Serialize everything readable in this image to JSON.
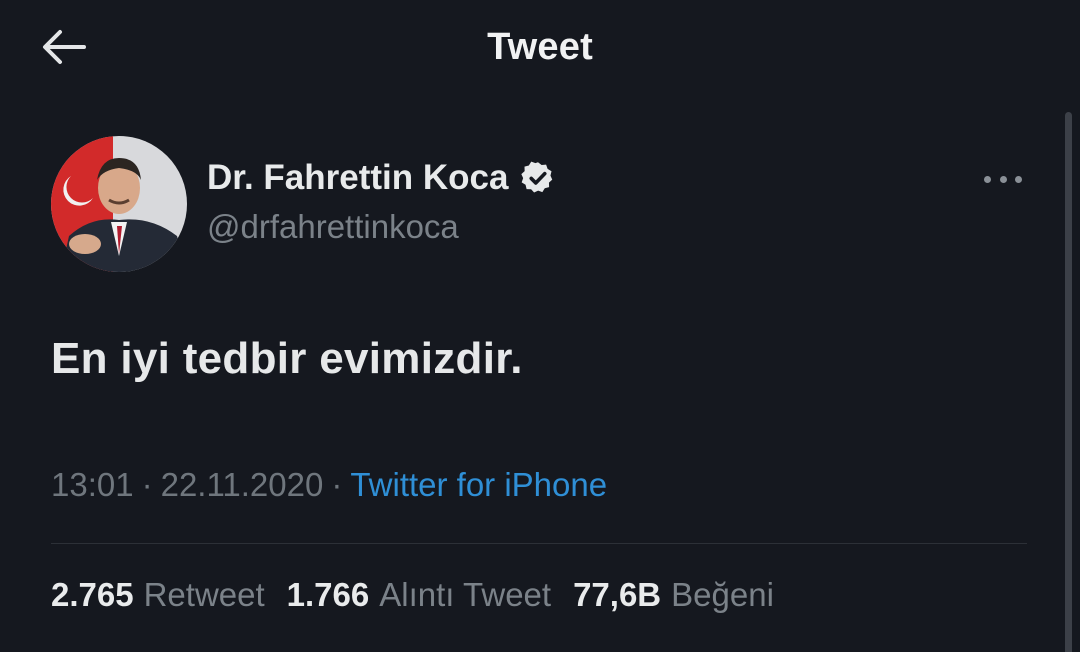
{
  "header": {
    "title": "Tweet"
  },
  "author": {
    "name": "Dr. Fahrettin Koca",
    "handle": "@drfahrettinkoca",
    "verified": true
  },
  "tweet": {
    "text": "En iyi tedbir evimizdir.",
    "time": "13:01",
    "date": "22.11.2020",
    "separator": "·",
    "source": "Twitter for iPhone"
  },
  "stats": [
    {
      "value": "2.765",
      "label": "Retweet"
    },
    {
      "value": "1.766",
      "label": "Alıntı Tweet"
    },
    {
      "value": "77,6B",
      "label": "Beğeni"
    }
  ],
  "colors": {
    "background": "#15181f",
    "link": "#2f8fd6",
    "muted": "#7b8289"
  }
}
